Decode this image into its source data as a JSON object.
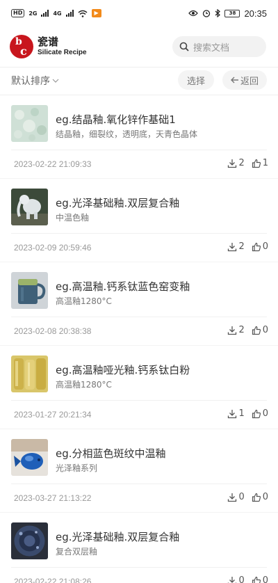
{
  "statusbar": {
    "left_chip": "HD",
    "left_small1": "2G",
    "left_small2": "4G",
    "battery": "38",
    "time": "20:35"
  },
  "header": {
    "logo_line1": "b",
    "logo_line2": "c",
    "brand_cn": "瓷谱",
    "brand_en": "Silicate Recipe",
    "search_placeholder": "搜索文档"
  },
  "toolbar": {
    "sort_label": "默认排序",
    "select_label": "选择",
    "back_label": "返回"
  },
  "items": [
    {
      "title": "eg.结晶釉.氧化锌作基础1",
      "subtitle": "结晶釉，细裂纹，透明底，天青色晶体",
      "date": "2023-02-22 21:09:33",
      "downloads": "2",
      "likes": "1",
      "thumb": "crystal"
    },
    {
      "title": "eg.光泽基础釉.双层复合釉",
      "subtitle": "中温色釉",
      "date": "2023-02-09 20:59:46",
      "downloads": "2",
      "likes": "0",
      "thumb": "elephant"
    },
    {
      "title": "eg.高温釉.钙系钛蓝色窑变釉",
      "subtitle": "高温釉1280°C",
      "date": "2023-02-08 20:38:38",
      "downloads": "2",
      "likes": "0",
      "thumb": "mug"
    },
    {
      "title": "eg.高温釉哑光釉.钙系钛白粉",
      "subtitle": "高温釉1280°C",
      "date": "2023-01-27 20:21:34",
      "downloads": "1",
      "likes": "0",
      "thumb": "yellow"
    },
    {
      "title": "eg.分相蓝色斑纹中温釉",
      "subtitle": "光泽釉系列",
      "date": "2023-03-27 21:13:22",
      "downloads": "0",
      "likes": "0",
      "thumb": "blue"
    },
    {
      "title": "eg.光泽基础釉.双层复合釉",
      "subtitle": "复合双层釉",
      "date": "2023-02-22 21:08:26",
      "downloads": "0",
      "likes": "0",
      "thumb": "plate"
    }
  ]
}
